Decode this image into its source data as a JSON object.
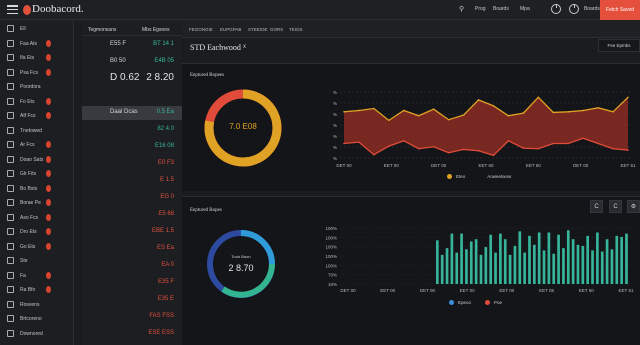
{
  "app": {
    "brand": "Doobacord.",
    "cta_label": "Fetch Saved"
  },
  "topbar": {
    "icon_search": "⚲",
    "link_1": "Prog",
    "link_2": "Boards",
    "link_3": "Mpa"
  },
  "sidebar": {
    "items": [
      {
        "label": "Ell",
        "icon": "grid-icon",
        "badge": false
      },
      {
        "label": "Faa  Ats",
        "icon": "list-icon",
        "badge": true
      },
      {
        "label": "Ifa  Ets",
        "icon": "chart-icon",
        "badge": true
      },
      {
        "label": "Psa  Fcs",
        "icon": "doc-icon",
        "badge": true
      },
      {
        "label": "Poordora",
        "icon": "folder-icon",
        "badge": false
      },
      {
        "label": "Fo  Ets",
        "icon": "tag-icon",
        "badge": true
      },
      {
        "label": "Atf  Fcs",
        "icon": "box-icon",
        "badge": true
      },
      {
        "label": "Tnetowed",
        "icon": "check-icon",
        "badge": false
      },
      {
        "label": "Ar  Fcs",
        "icon": "file-icon",
        "badge": true
      },
      {
        "label": "Doao  Sats",
        "icon": "table-icon",
        "badge": true
      },
      {
        "label": "Glr  Fits",
        "icon": "clip-icon",
        "badge": true
      },
      {
        "label": "Bo  Bsts",
        "icon": "user-icon",
        "badge": true
      },
      {
        "label": "Borae  Pe",
        "icon": "window-icon",
        "badge": true
      },
      {
        "label": "Aso  Fcs",
        "icon": "mail-icon",
        "badge": true
      },
      {
        "label": "Dro  Ets",
        "icon": "card-icon",
        "badge": true
      },
      {
        "label": "Go  Ets",
        "icon": "bars-icon",
        "badge": true
      },
      {
        "label": "Ste",
        "icon": "home-icon",
        "badge": false
      },
      {
        "label": "Fa",
        "icon": "chip-icon",
        "badge": true
      },
      {
        "label": "Ra  Bfo",
        "icon": "power-icon",
        "badge": true
      },
      {
        "label": "Rosvens",
        "icon": "gear-icon",
        "badge": false
      },
      {
        "label": "Brtcoreno",
        "icon": "grid-icon",
        "badge": false
      },
      {
        "label": "Downored",
        "icon": "clock-icon",
        "badge": false
      }
    ]
  },
  "midpanel": {
    "head_left": "Tegmonsans",
    "head_right": "Mbs Egsnes",
    "rows": [
      {
        "c1": "E55 F",
        "c2": "BT 14 1",
        "c2_color": "teal",
        "big": false
      },
      {
        "c1": "B0 50",
        "c2": "E4B 05",
        "c2_color": "teal",
        "big": false
      },
      {
        "c1": "D 0.62",
        "c2": "2 8.20",
        "c2_color": "",
        "big": true
      },
      {
        "c1": "",
        "c2": "",
        "c2_color": "",
        "big": false
      },
      {
        "c1": "Daal Dcas",
        "c2": "0.5 Ea",
        "c2_color": "teal",
        "big": false,
        "selected": true
      },
      {
        "c1": "",
        "c2": "82 4.0",
        "c2_color": "teal",
        "big": false
      },
      {
        "c1": "",
        "c2": "E16 08",
        "c2_color": "teal",
        "big": false
      },
      {
        "c1": "",
        "c2": "E0 F3",
        "c2_color": "red",
        "big": false
      },
      {
        "c1": "",
        "c2": "E 1.5",
        "c2_color": "red",
        "big": false
      },
      {
        "c1": "",
        "c2": "EG 0",
        "c2_color": "red",
        "big": false
      },
      {
        "c1": "",
        "c2": "E5 68",
        "c2_color": "red",
        "big": false
      },
      {
        "c1": "",
        "c2": "EBE 1.5",
        "c2_color": "red",
        "big": false
      },
      {
        "c1": "",
        "c2": "ES Ea",
        "c2_color": "red",
        "big": false
      },
      {
        "c1": "",
        "c2": "EA 0",
        "c2_color": "red",
        "big": false
      },
      {
        "c1": "",
        "c2": "E35 F",
        "c2_color": "red",
        "big": false
      },
      {
        "c1": "",
        "c2": "E35 E",
        "c2_color": "red",
        "big": false
      },
      {
        "c1": "",
        "c2": "FAS FSS",
        "c2_color": "red",
        "big": false
      },
      {
        "c1": "",
        "c2": "ESE ESS",
        "c2_color": "red",
        "big": false
      }
    ]
  },
  "tabs": [
    "FEGONGIE",
    "EUPGPAB",
    "STEEIOE",
    "GORS",
    "TEIOS"
  ],
  "page": {
    "title": "STD  Eachwood",
    "close": "x",
    "filter_label": "Fee  Epmbs"
  },
  "card1": {
    "title": "Eeptured  Bopees",
    "donut_value": "7.0  E08",
    "donut_pct": 0.78,
    "legend": [
      {
        "label": "Eteo",
        "color": "#e0a224"
      },
      {
        "label": "Aoweetwow",
        "color": ""
      }
    ]
  },
  "card2": {
    "title": "Eeptured  Bopes",
    "donut_value": "2 8.70",
    "donut_sub": "Tooh  Boon",
    "legend": [
      {
        "label": "Epeoo",
        "color": "#3a8fd6"
      },
      {
        "label": "Poe",
        "color": "#e04b3a"
      }
    ],
    "btn_1": "C",
    "btn_2": "C",
    "btn_3": "⚙"
  },
  "colors": {
    "accent": "#e5503c",
    "teal": "#36b59b",
    "amber": "#e0a224",
    "blue": "#3a8fd6"
  },
  "chart_data": [
    {
      "type": "line",
      "title": "Eeptured  Bopees",
      "x": [
        "DET 00",
        "EET 00",
        "DET 00",
        "EET 60",
        "EET 60",
        "DET 00",
        "EET 61"
      ],
      "ylim": [
        0,
        100
      ],
      "yticks": [
        "%",
        "%",
        "%",
        "%",
        "%",
        "%",
        "%"
      ],
      "series": [
        {
          "name": "Eteo",
          "color": "#e0a224",
          "values": [
            70,
            72,
            75,
            57,
            72,
            64,
            74,
            58,
            65,
            88,
            79,
            64,
            68,
            92,
            69,
            70,
            72,
            76,
            70,
            92
          ]
        },
        {
          "name": "Aoweetwow",
          "color": "#e04b3a",
          "values": [
            22,
            24,
            5,
            18,
            26,
            14,
            17,
            8,
            13,
            11,
            4,
            26,
            15,
            14,
            22,
            22,
            30,
            22,
            14,
            12
          ]
        }
      ]
    },
    {
      "type": "bar",
      "title": "Eeptured  Bopes",
      "x": [
        "DET 00",
        "EET 00",
        "DET 00",
        "EET 00",
        "EET 00",
        "EET 05",
        "EET 60",
        "EET 61"
      ],
      "ylim": [
        0,
        100
      ],
      "yticks": [
        "100%",
        "100%",
        "100%",
        "100%",
        "100%",
        "70%",
        "10%"
      ],
      "values": [
        78,
        52,
        64,
        90,
        56,
        90,
        62,
        76,
        80,
        52,
        66,
        88,
        56,
        90,
        80,
        52,
        68,
        94,
        56,
        86,
        70,
        92,
        60,
        92,
        54,
        88,
        64,
        96,
        80,
        70,
        68,
        86,
        60,
        92,
        58,
        80,
        62,
        86,
        84,
        90
      ]
    }
  ]
}
